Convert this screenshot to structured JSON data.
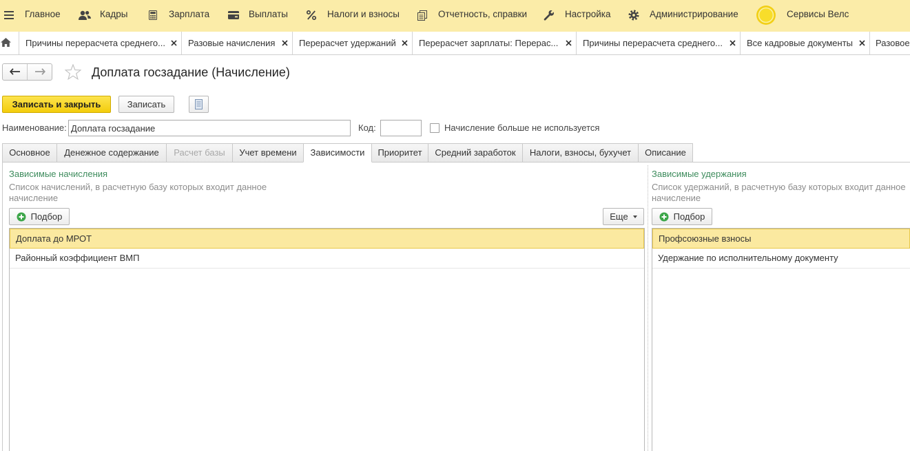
{
  "top_menu": {
    "items": [
      {
        "label": "Главное",
        "icon": "menu-icon"
      },
      {
        "label": "Кадры",
        "icon": "people-icon"
      },
      {
        "label": "Зарплата",
        "icon": "calculator-icon"
      },
      {
        "label": "Выплаты",
        "icon": "wallet-icon"
      },
      {
        "label": "Налоги и взносы",
        "icon": "percent-icon"
      },
      {
        "label": "Отчетность, справки",
        "icon": "reports-icon"
      },
      {
        "label": "Настройка",
        "icon": "wrench-icon"
      },
      {
        "label": "Администрирование",
        "icon": "gear-icon"
      },
      {
        "label": "Сервисы Велс",
        "icon": "services-circle-icon"
      }
    ]
  },
  "open_tabs": {
    "home_icon": "home-icon",
    "items": [
      {
        "label": "Причины перерасчета среднего...",
        "closable": true
      },
      {
        "label": "Разовые начисления",
        "closable": true
      },
      {
        "label": "Перерасчет удержаний",
        "closable": true
      },
      {
        "label": "Перерасчет зарплаты: Перерас...",
        "closable": true
      },
      {
        "label": "Причины перерасчета среднего...",
        "closable": true
      },
      {
        "label": "Все кадровые документы",
        "closable": true
      },
      {
        "label": "Разовое",
        "closable": false
      }
    ]
  },
  "form": {
    "title": "Доплата госзадание (Начисление)",
    "icons": {
      "back": "arrow-left-icon",
      "forward": "arrow-right-icon",
      "favorite": "star-icon",
      "list": "document-list-icon"
    },
    "toolbar": {
      "save_close_label": "Записать и закрыть",
      "save_label": "Записать"
    },
    "fields": {
      "name_label": "Наименование:",
      "name_value": "Доплата госзадание",
      "code_label": "Код:",
      "unused_label": "Начисление больше не используется",
      "unused_checked": false
    },
    "tabs": [
      {
        "label": "Основное"
      },
      {
        "label": "Денежное содержание"
      },
      {
        "label": "Расчет базы"
      },
      {
        "label": "Учет времени"
      },
      {
        "label": "Зависимости"
      },
      {
        "label": "Приоритет"
      },
      {
        "label": "Средний заработок"
      },
      {
        "label": "Налоги, взносы, бухучет"
      },
      {
        "label": "Описание"
      }
    ],
    "active_tab_index": 4,
    "disabled_tab_indices": [
      2
    ],
    "dependent_accruals": {
      "title": "Зависимые начисления",
      "description": "Список начислений, в расчетную базу которых входит данное начисление",
      "pick_label": "Подбор",
      "more_label": "Еще",
      "rows": [
        "Доплата до МРОТ",
        "Районный коэффициент ВМП"
      ],
      "selected_row_index": 0
    },
    "dependent_deductions": {
      "title": "Зависимые удержания",
      "description": "Список удержаний, в расчетную базу которых входит данное начисление",
      "pick_label": "Подбор",
      "rows": [
        "Профсоюзные взносы",
        "Удержание по исполнительному документу"
      ],
      "selected_row_index": 0
    }
  },
  "colors": {
    "top_bar": "#fbeca8",
    "primary_button": "#f7d51d",
    "selected_row": "#fbe9a0",
    "group_title": "#3e8c5d"
  }
}
